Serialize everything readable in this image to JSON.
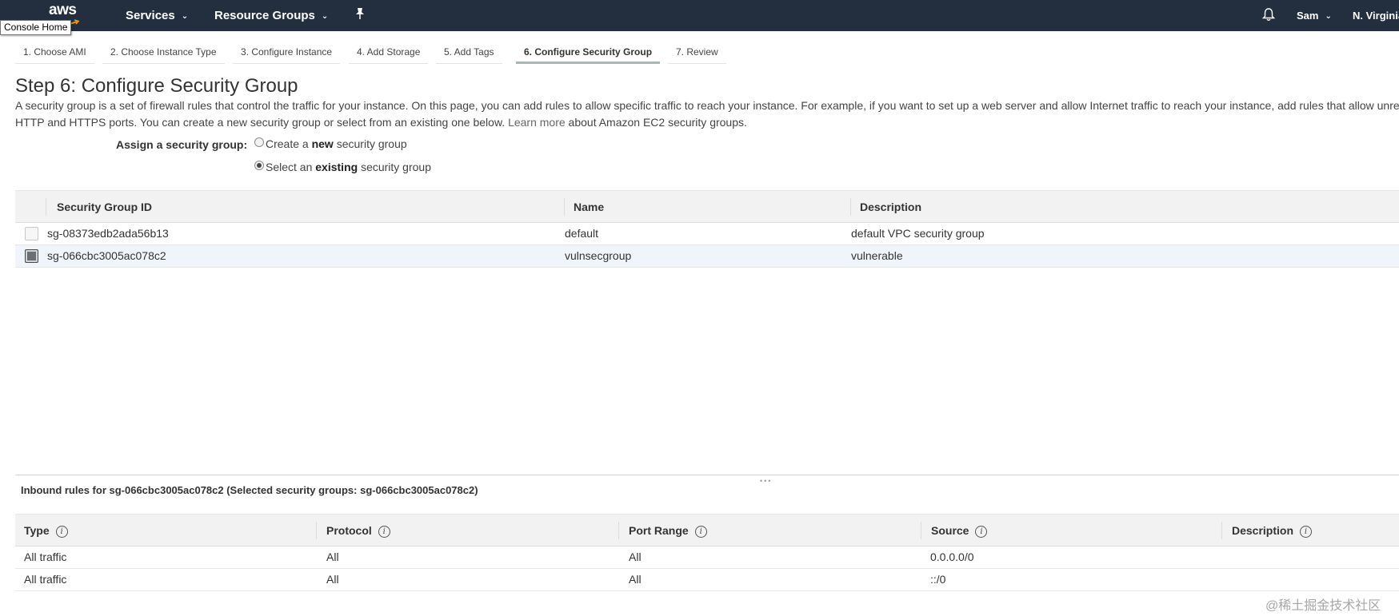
{
  "nav": {
    "logo": "aws",
    "services": "Services",
    "resource_groups": "Resource Groups",
    "user": "Sam",
    "region": "N. Virginia",
    "tooltip": "Console Home"
  },
  "steps": [
    {
      "label": "1. Choose AMI"
    },
    {
      "label": "2. Choose Instance Type"
    },
    {
      "label": "3. Configure Instance"
    },
    {
      "label": "4. Add Storage"
    },
    {
      "label": "5. Add Tags"
    },
    {
      "label": "6. Configure Security Group"
    },
    {
      "label": "7. Review"
    }
  ],
  "page": {
    "title": "Step 6: Configure Security Group",
    "desc_line1": "A security group is a set of firewall rules that control the traffic for your instance. On this page, you can add rules to allow specific traffic to reach your instance. For example, if you want to set up a web server and allow Internet traffic to reach your instance, add rules that allow unre",
    "desc_line2_pre": "HTTP and HTTPS ports. You can create a new security group or select from an existing one below.",
    "learn_more": "Learn more",
    "desc_line2_post": "about Amazon EC2 security groups."
  },
  "assign": {
    "label": "Assign a security group:",
    "new_pre": "Create a ",
    "new_bold": "new",
    "new_post": " security group",
    "existing_pre": "Select an ",
    "existing_bold": "existing",
    "existing_post": " security group",
    "selected": "existing"
  },
  "sg_table": {
    "headers": [
      "Security Group ID",
      "Name",
      "Description"
    ],
    "rows": [
      {
        "id": "sg-08373edb2ada56b13",
        "name": "default",
        "description": "default VPC security group",
        "selected": false
      },
      {
        "id": "sg-066cbc3005ac078c2",
        "name": "vulnsecgroup",
        "description": "vulnerable",
        "selected": true
      }
    ]
  },
  "inbound": {
    "title": "Inbound rules for sg-066cbc3005ac078c2 (Selected security groups: sg-066cbc3005ac078c2)",
    "headers": [
      "Type",
      "Protocol",
      "Port Range",
      "Source",
      "Description"
    ],
    "rows": [
      {
        "type": "All traffic",
        "protocol": "All",
        "port_range": "All",
        "source": "0.0.0.0/0",
        "description": ""
      },
      {
        "type": "All traffic",
        "protocol": "All",
        "port_range": "All",
        "source": "::/0",
        "description": ""
      }
    ]
  },
  "watermark": "@稀土掘金技术社区",
  "colors": {
    "nav_bg": "#232f3e",
    "selected_row_bg": "#f0f5fb",
    "header_bg": "#f2f2f2"
  },
  "icons": {
    "pin": "pin-icon",
    "bell": "bell-icon",
    "chevron": "chevron-down-icon",
    "info": "info-icon"
  }
}
